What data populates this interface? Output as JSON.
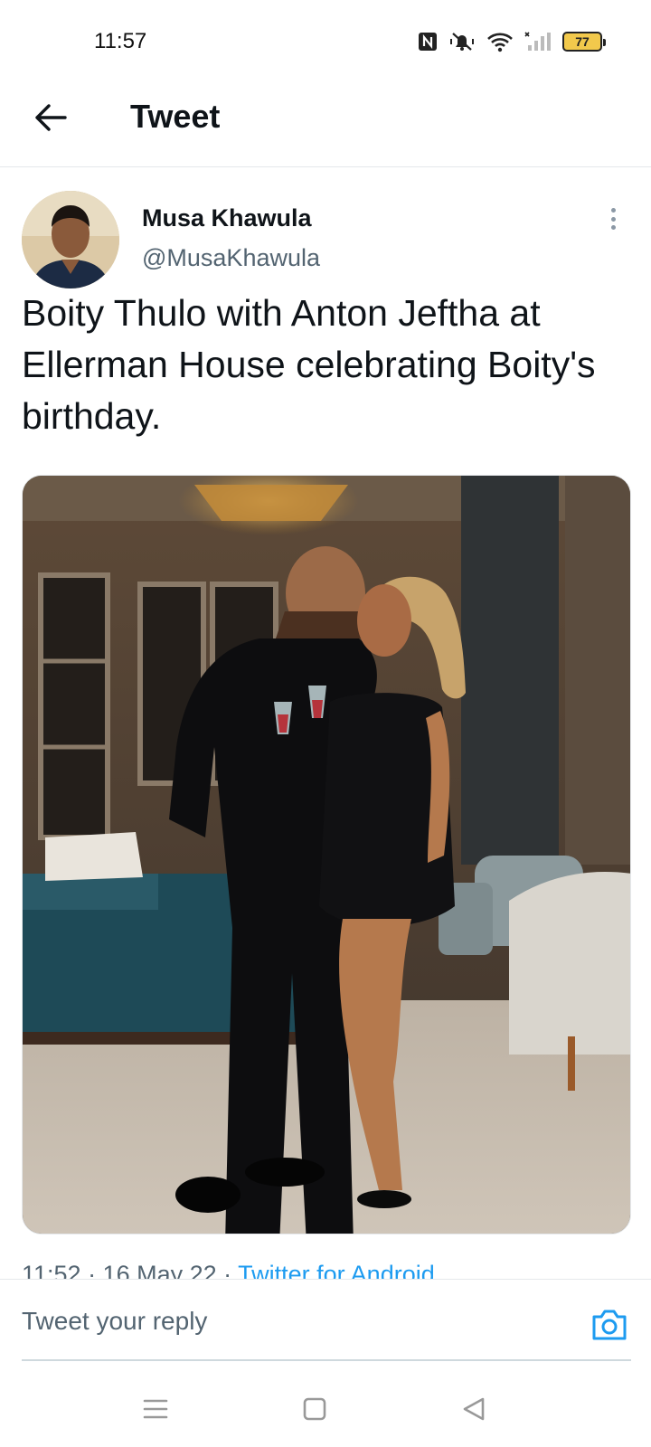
{
  "status_bar": {
    "time": "11:57",
    "battery": "77",
    "icons": [
      "nfc-icon",
      "vibrate-off-icon",
      "wifi-icon",
      "signal-icon",
      "battery-icon"
    ]
  },
  "header": {
    "title": "Tweet",
    "back_icon": "arrow-left-icon"
  },
  "tweet": {
    "author_name": "Musa Khawula",
    "author_handle": "@MusaKhawula",
    "text": "Boity Thulo with Anton Jeftha at Ellerman House celebrating Boity's birthday.",
    "meta_time": "11:52 · 16 May 22 · ",
    "meta_source": "Twitter for Android"
  },
  "reply": {
    "placeholder": "Tweet your reply",
    "camera_icon": "camera-icon"
  },
  "nav": {
    "menu_icon": "menu-icon",
    "home_icon": "square-home-icon",
    "back_icon": "triangle-back-icon"
  },
  "colors": {
    "accent": "#1d9bf0",
    "text_primary": "#0f1419",
    "text_secondary": "#536471",
    "battery_fill": "#f2c94c"
  }
}
